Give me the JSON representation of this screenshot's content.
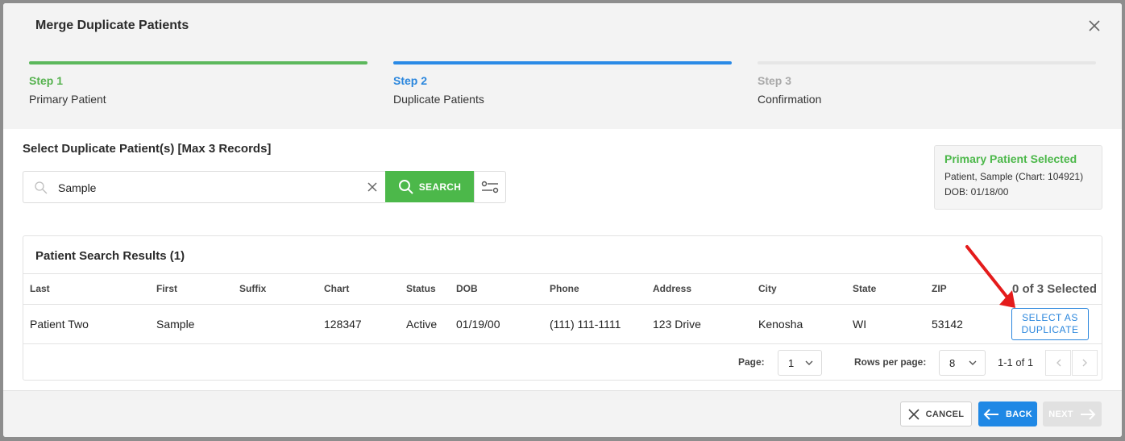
{
  "modal": {
    "title": "Merge Duplicate Patients"
  },
  "steps": [
    {
      "num": "Step 1",
      "label": "Primary Patient"
    },
    {
      "num": "Step 2",
      "label": "Duplicate Patients"
    },
    {
      "num": "Step 3",
      "label": "Confirmation"
    }
  ],
  "section": {
    "heading": "Select Duplicate Patient(s) [Max 3 Records]"
  },
  "search": {
    "value": "Sample",
    "button_label": "SEARCH"
  },
  "primary": {
    "title": "Primary Patient Selected",
    "line1": "Patient, Sample (Chart: 104921)",
    "line2": "DOB: 01/18/00"
  },
  "results": {
    "title": "Patient Search Results (1)",
    "columns": [
      "Last",
      "First",
      "Suffix",
      "Chart",
      "Status",
      "DOB",
      "Phone",
      "Address",
      "City",
      "State",
      "ZIP"
    ],
    "selected_count": "0 of 3 Selected",
    "rows": [
      {
        "last": "Patient Two",
        "first": "Sample",
        "suffix": "",
        "chart": "128347",
        "status": "Active",
        "dob": "01/19/00",
        "phone": "(111) 111-1111",
        "address": "123 Drive",
        "city": "Kenosha",
        "state": "WI",
        "zip": "53142",
        "action_line1": "SELECT AS",
        "action_line2": "DUPLICATE"
      }
    ]
  },
  "pager": {
    "page_label": "Page:",
    "page_value": "1",
    "rows_label": "Rows per page:",
    "rows_value": "8",
    "range": "1-1 of 1"
  },
  "footer": {
    "cancel": "CANCEL",
    "back": "BACK",
    "next": "NEXT"
  },
  "colors": {
    "green": "#4cb84a",
    "blue": "#1f88e5",
    "annotation_red": "#e41b1b"
  }
}
